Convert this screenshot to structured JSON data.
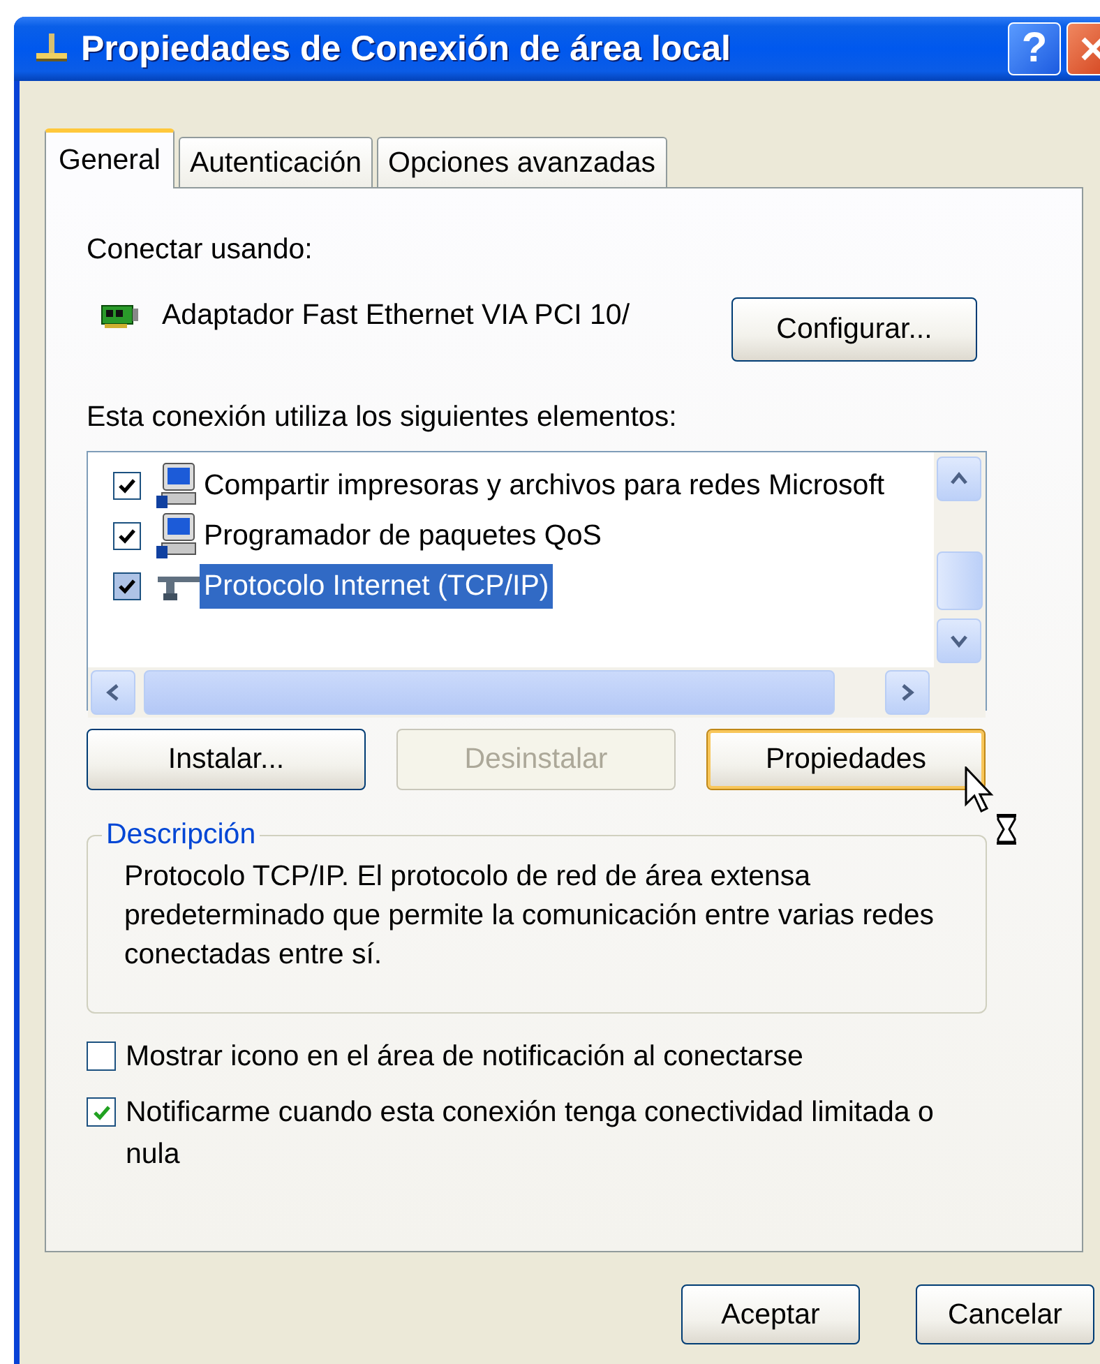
{
  "window": {
    "title": "Propiedades de Conexión de área local"
  },
  "title_buttons": [
    {
      "kind": "help",
      "label": "?"
    },
    {
      "kind": "close"
    }
  ],
  "tabs": [
    {
      "label": "General",
      "selected": true
    },
    {
      "label": "Autenticación",
      "selected": false
    },
    {
      "label": "Opciones avanzadas",
      "selected": false
    }
  ],
  "connect_using": {
    "label": "Conectar usando:",
    "adapter": "Adaptador Fast Ethernet VIA PCI 10/",
    "button": "Configurar..."
  },
  "components": {
    "label": "Esta conexión utiliza los siguientes elementos:",
    "items": [
      {
        "name": "Compartir impresoras y archivos para redes Microsoft",
        "kind": "computer",
        "checked": true,
        "selected": false
      },
      {
        "name": "Programador de paquetes QoS",
        "kind": "computer",
        "checked": true,
        "selected": false
      },
      {
        "name": "Protocolo Internet (TCP/IP)",
        "kind": "protocol",
        "checked": true,
        "selected": true
      }
    ]
  },
  "component_buttons": [
    {
      "label": "Instalar...",
      "disabled": false,
      "hovered": false
    },
    {
      "label": "Desinstalar",
      "disabled": true,
      "hovered": false
    },
    {
      "label": "Propiedades",
      "disabled": false,
      "hovered": true
    }
  ],
  "description": {
    "title": "Descripción",
    "text": "Protocolo TCP/IP. El protocolo de red de área extensa predeterminado que permite la comunicación entre varias redes conectadas entre sí."
  },
  "options": [
    {
      "label": "Mostrar icono en el área de notificación al conectarse",
      "checked": false
    },
    {
      "label": "Notificarme cuando esta conexión tenga conectividad limitada o nula",
      "checked": true
    }
  ],
  "footer_buttons": [
    "Aceptar",
    "Cancelar"
  ]
}
